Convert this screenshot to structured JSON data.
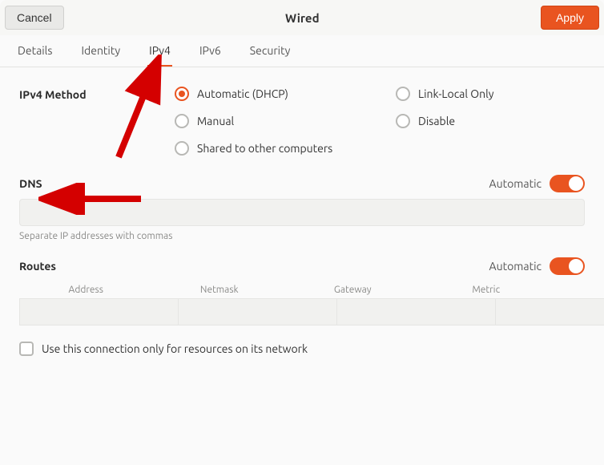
{
  "header": {
    "cancel_label": "Cancel",
    "title": "Wired",
    "apply_label": "Apply"
  },
  "tabs": {
    "details": "Details",
    "identity": "Identity",
    "ipv4": "IPv4",
    "ipv6": "IPv6",
    "security": "Security",
    "active": "ipv4"
  },
  "ipv4": {
    "method_label": "IPv4 Method",
    "options": {
      "automatic": "Automatic (DHCP)",
      "manual": "Manual",
      "shared": "Shared to other computers",
      "link_local": "Link-Local Only",
      "disable": "Disable"
    },
    "selected": "automatic"
  },
  "dns": {
    "title": "DNS",
    "automatic_label": "Automatic",
    "automatic_on": true,
    "value": "",
    "hint": "Separate IP addresses with commas"
  },
  "routes": {
    "title": "Routes",
    "automatic_label": "Automatic",
    "automatic_on": true,
    "columns": {
      "address": "Address",
      "netmask": "Netmask",
      "gateway": "Gateway",
      "metric": "Metric"
    },
    "rows": [
      {
        "address": "",
        "netmask": "",
        "gateway": "",
        "metric": ""
      }
    ],
    "own_resources_label": "Use this connection only for resources on its network",
    "own_resources_checked": false
  },
  "icons": {
    "trash": "trash-icon"
  },
  "colors": {
    "accent": "#e95420"
  }
}
